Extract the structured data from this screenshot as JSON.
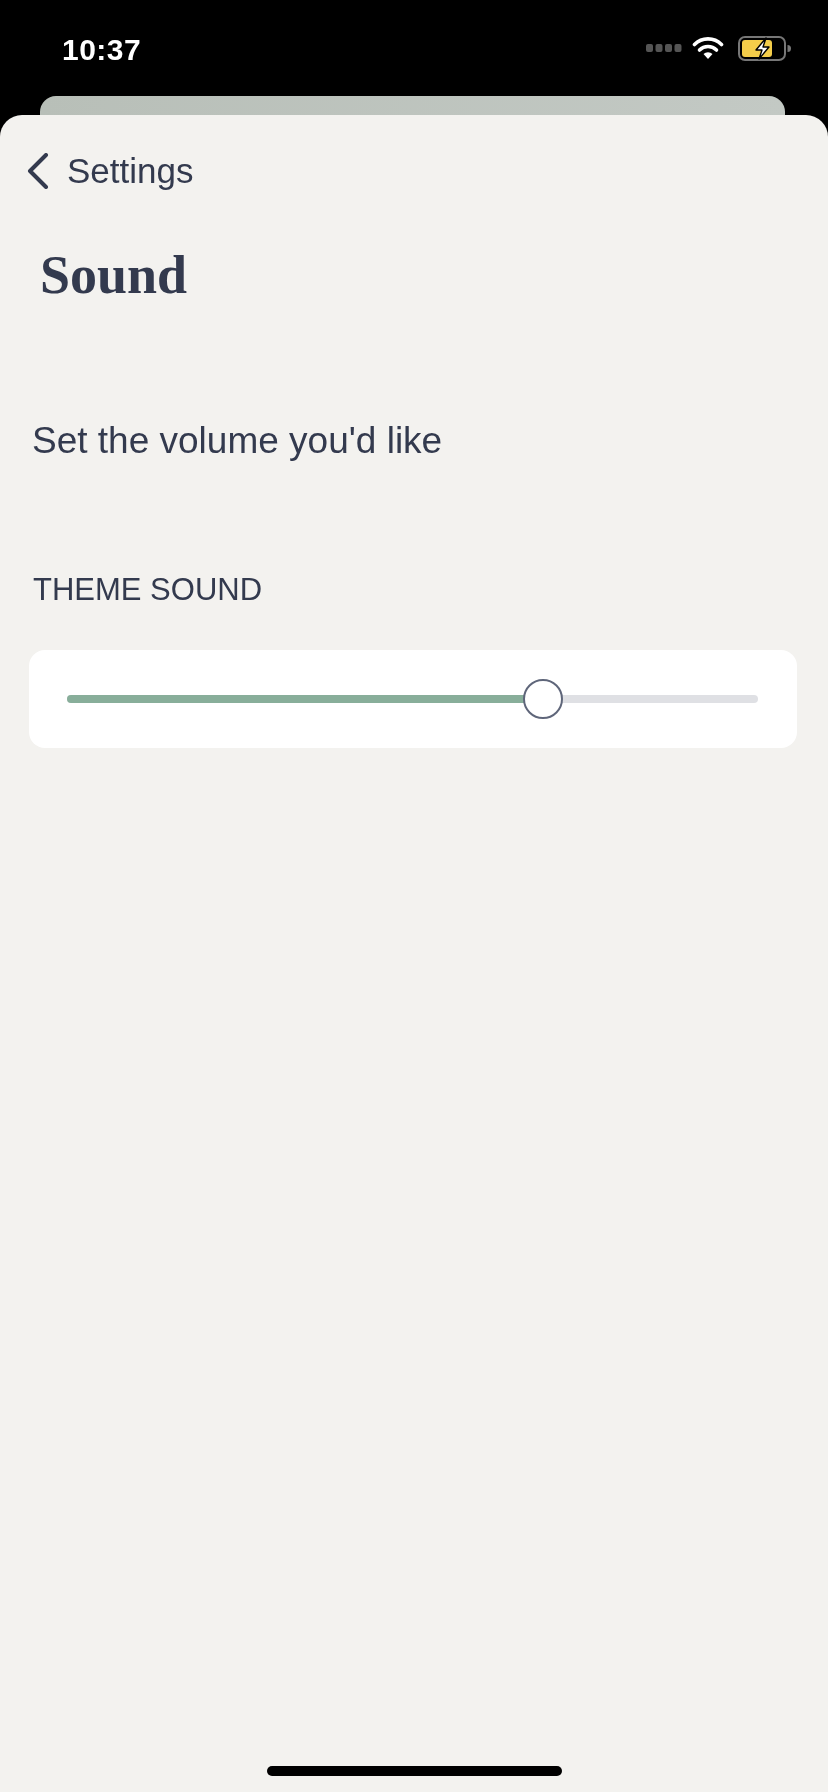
{
  "status_bar": {
    "time": "10:37"
  },
  "nav": {
    "back_label": "Settings"
  },
  "title": "Sound",
  "prompt": "Set the volume you'd like",
  "section": {
    "label": "THEME SOUND",
    "slider": {
      "level": 0.7
    }
  }
}
